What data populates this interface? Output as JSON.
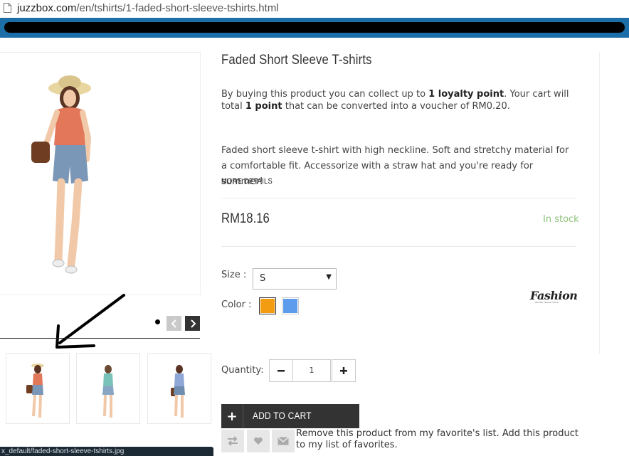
{
  "browser": {
    "url_domain": "juzzbox.com",
    "url_path": "/en/tshirts/1-faded-short-sleeve-tshirts.html",
    "status_url": "x_default/faded-short-sleeve-tshirts.jpg"
  },
  "product": {
    "title": "Faded Short Sleeve T-shirts",
    "loyalty": {
      "part1": "By buying this product you can collect up to ",
      "points": "1 loyalty point",
      "part2": ". Your cart will total ",
      "total": "1 point",
      "part3": " that can be converted into a voucher of RM0.20."
    },
    "description": "Faded short sleeve t-shirt with high neckline. Soft and stretchy material for a comfortable fit. Accessorize with a straw hat and you're ready for summer!",
    "more_details": "MORE DETAILS",
    "price": "RM18.16",
    "stock": "In stock",
    "size_label": "Size :",
    "size_value": "S",
    "color_label": "Color :",
    "colors": [
      "#f39c11",
      "#5d9cec"
    ],
    "brand_logo": "Fashion",
    "brand_tagline": "Women Fashion Store",
    "quantity_label": "Quantity:",
    "quantity_value": "1",
    "add_to_cart": "ADD TO CART",
    "favorites_text": "Remove this product from my favorite's list. Add this product to my list of favorites."
  },
  "gallery": {
    "thumb_count": 3
  },
  "icons": [
    "page-icon",
    "prev-icon",
    "next-icon",
    "minus-icon",
    "plus-icon",
    "cart-plus-icon",
    "compare-icon",
    "heart-icon",
    "mail-icon",
    "arrow-annotation-icon"
  ]
}
